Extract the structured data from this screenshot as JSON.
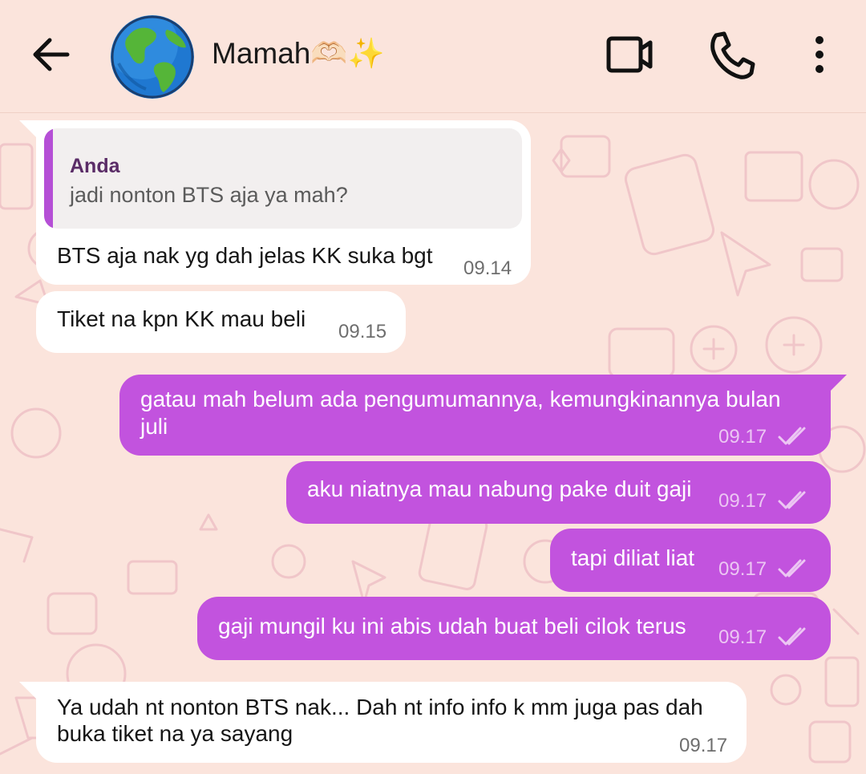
{
  "header": {
    "contact_name": "Mamah🫶🏻✨",
    "back_icon": "arrow-left-icon",
    "video_icon": "video-camera-icon",
    "call_icon": "phone-icon",
    "menu_icon": "more-vertical-icon",
    "avatar_icon": "globe-icon"
  },
  "messages": [
    {
      "direction": "incoming",
      "quote": {
        "author": "Anda",
        "text": "jadi nonton BTS aja ya mah?"
      },
      "lines": [
        "BTS aja nak yg dah jelas KK suka bgt"
      ],
      "time": "09.14"
    },
    {
      "direction": "incoming",
      "lines": [
        "Tiket na kpn KK mau beli"
      ],
      "time": "09.15"
    },
    {
      "direction": "outgoing",
      "lines": [
        "gatau mah belum ada pengumumannya, kemungkinannya bulan",
        "juli"
      ],
      "time": "09.17",
      "status": "read"
    },
    {
      "direction": "outgoing",
      "lines": [
        "aku niatnya mau nabung pake duit gaji"
      ],
      "time": "09.17",
      "status": "read"
    },
    {
      "direction": "outgoing",
      "lines": [
        "tapi diliat liat"
      ],
      "time": "09.17",
      "status": "read"
    },
    {
      "direction": "outgoing",
      "lines": [
        "gaji mungil ku ini abis udah buat beli cilok terus"
      ],
      "time": "09.17",
      "status": "read"
    },
    {
      "direction": "incoming",
      "lines": [
        "Ya udah nt nonton BTS nak...  Dah nt info info k mm juga pas dah",
        "buka tiket na ya sayang"
      ],
      "time": "09.17"
    }
  ],
  "colors": {
    "background": "#fbe4dc",
    "pattern": "#f0c6c9",
    "outgoing_bubble": "#c253de",
    "incoming_bubble": "#ffffff",
    "quote_bar": "#b54fd6"
  }
}
